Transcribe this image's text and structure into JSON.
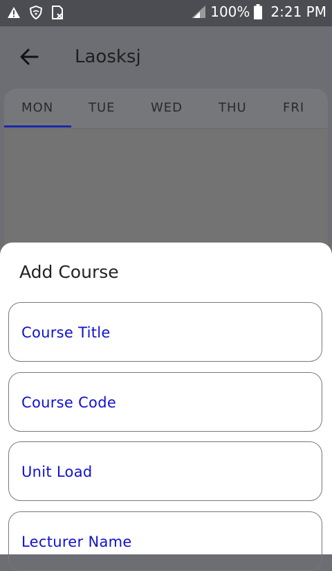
{
  "status_bar": {
    "battery": "100%",
    "time": "2:21 PM"
  },
  "app_bar": {
    "title": "Laosksj"
  },
  "tabs": [
    {
      "label": "MON",
      "selected": true
    },
    {
      "label": "TUE",
      "selected": false
    },
    {
      "label": "WED",
      "selected": false
    },
    {
      "label": "THU",
      "selected": false
    },
    {
      "label": "FRI",
      "selected": false
    }
  ],
  "sheet": {
    "title": "Add Course",
    "fields": [
      {
        "label": "Course Title"
      },
      {
        "label": "Course Code"
      },
      {
        "label": "Unit Load"
      },
      {
        "label": "Lecturer Name"
      }
    ]
  },
  "colors": {
    "accent": "#1a27a8",
    "field_label": "#1010d0",
    "scrim": "#6d6e73"
  }
}
